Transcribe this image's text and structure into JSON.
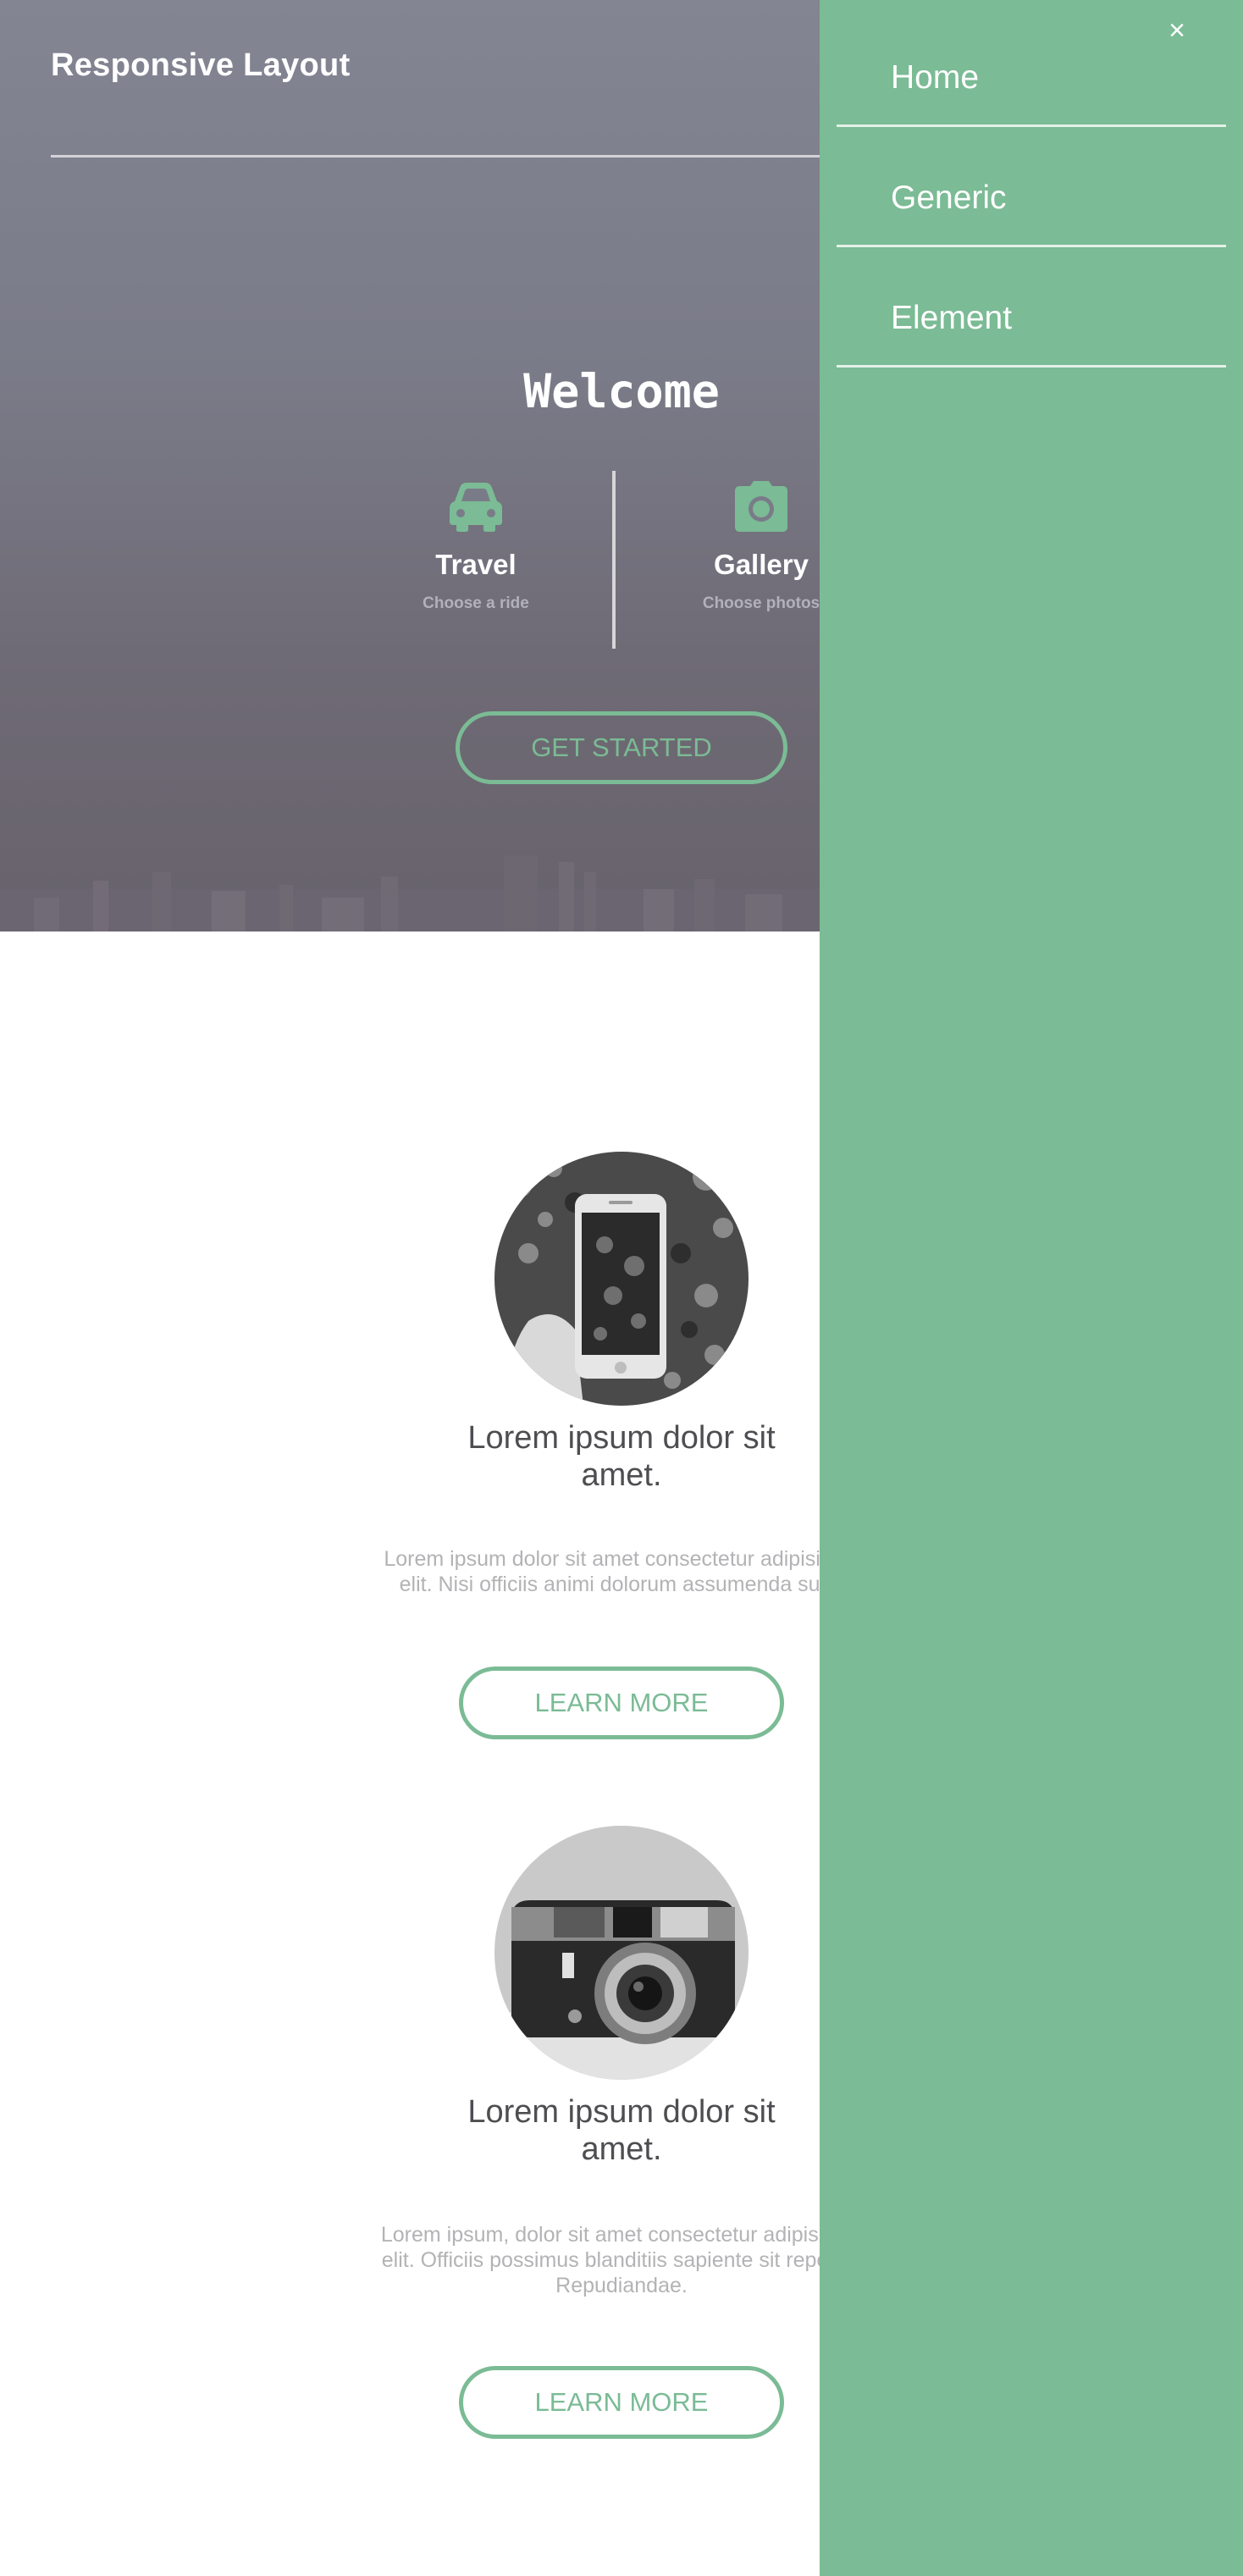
{
  "header": {
    "site_title": "Responsive Layout"
  },
  "hero": {
    "heading": "Welcome",
    "features": [
      {
        "icon": "car-icon",
        "title": "Travel",
        "subtitle": "Choose a ride"
      },
      {
        "icon": "camera-icon",
        "title": "Gallery",
        "subtitle": "Choose photos"
      }
    ],
    "cta_label": "GET STARTED"
  },
  "content": {
    "blocks": [
      {
        "image": "smartphone-photo",
        "title": "Lorem ipsum dolor sit amet.",
        "text": "Lorem ipsum dolor sit amet consectetur adipisicing elit. Nisi officiis animi dolorum assumenda sunt.",
        "button_label": "LEARN MORE"
      },
      {
        "image": "camera-photo",
        "title": "Lorem ipsum dolor sit amet.",
        "text": "Lorem ipsum, dolor sit amet consectetur adipisicing elit. Officiis possimus blanditiis sapiente sit repellat. Repudiandae.",
        "button_label": "LEARN MORE"
      }
    ]
  },
  "sidebar": {
    "close_label": "×",
    "items": [
      {
        "label": "Home"
      },
      {
        "label": "Generic"
      },
      {
        "label": "Element"
      }
    ]
  },
  "colors": {
    "accent": "#7bbb95",
    "hero_overlay": "#7c7d8b",
    "text_dark": "#4e4e52",
    "text_muted": "#b3b3b6"
  }
}
